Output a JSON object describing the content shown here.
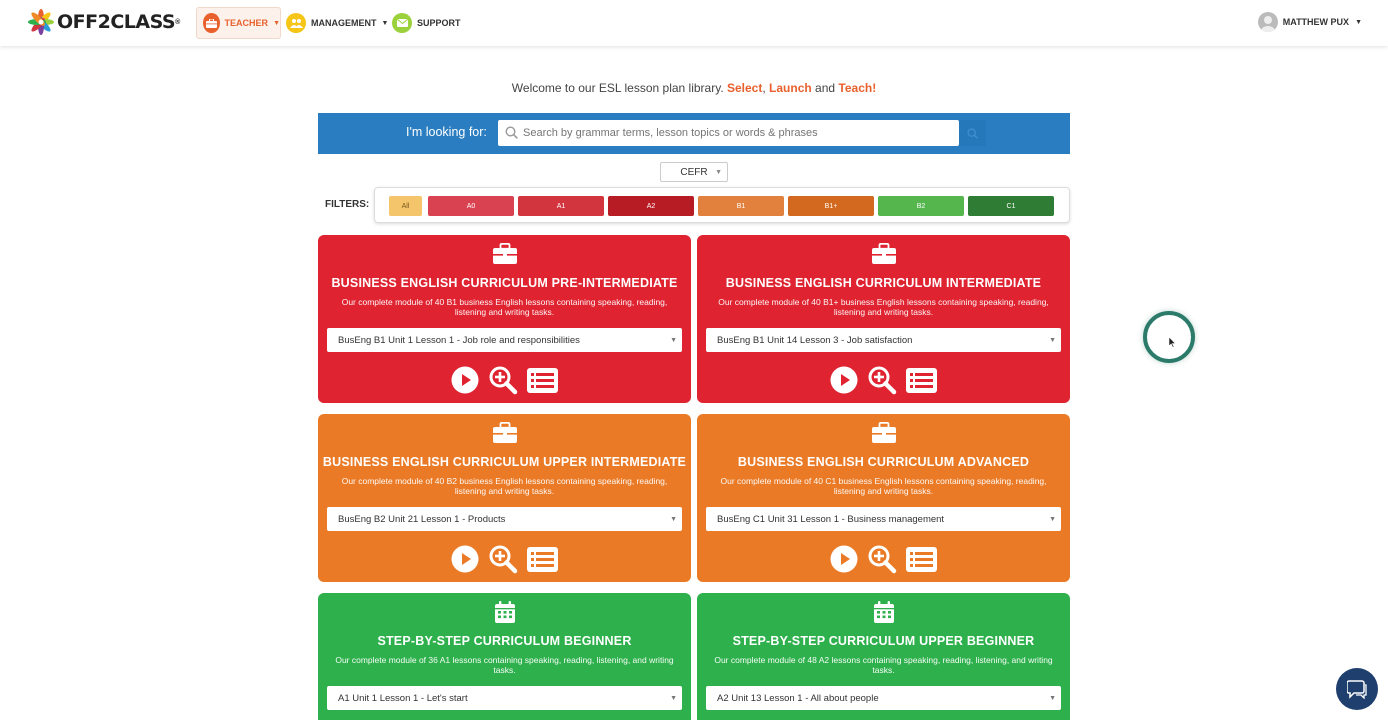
{
  "brand": {
    "name": "OFF2CLASS"
  },
  "nav": {
    "teacher": "TEACHER",
    "management": "MANAGEMENT",
    "support": "SUPPORT"
  },
  "user": {
    "name": "MATTHEW PUX"
  },
  "welcome": {
    "prefix": "Welcome to our ESL lesson plan library. ",
    "select": "Select",
    "comma": ", ",
    "launch": "Launch",
    "and": " and ",
    "teach": "Teach!"
  },
  "search": {
    "label": "I'm looking for:",
    "placeholder": "Search by grammar terms, lesson topics or words & phrases"
  },
  "cefr": {
    "selected": "CEFR"
  },
  "filters": {
    "label": "FILTERS:",
    "pills": [
      {
        "label": "All",
        "color": "#f5c56b"
      },
      {
        "label": "A0",
        "color": "#d94351"
      },
      {
        "label": "A1",
        "color": "#d3353f"
      },
      {
        "label": "A2",
        "color": "#b71c24"
      },
      {
        "label": "B1",
        "color": "#e2813d"
      },
      {
        "label": "B1+",
        "color": "#d2691e"
      },
      {
        "label": "B2",
        "color": "#56b64e"
      },
      {
        "label": "C1",
        "color": "#2f7d34"
      }
    ]
  },
  "cards": [
    {
      "title": "BUSINESS ENGLISH CURRICULUM PRE-INTERMEDIATE",
      "desc": "Our complete module of 40 B1 business English lessons containing speaking, reading, listening and writing tasks.",
      "selected": "BusEng B1 Unit 1 Lesson 1 - Job role and responsibilities",
      "icon": "briefcase-icon"
    },
    {
      "title": "BUSINESS ENGLISH CURRICULUM INTERMEDIATE",
      "desc": "Our complete module of 40 B1+ business English lessons containing speaking, reading, listening and writing tasks.",
      "selected": "BusEng B1 Unit 14 Lesson 3 - Job satisfaction",
      "icon": "briefcase-icon"
    },
    {
      "title": "BUSINESS ENGLISH CURRICULUM UPPER INTERMEDIATE",
      "desc": "Our complete module of 40 B2 business English lessons containing speaking, reading, listening and writing tasks.",
      "selected": "BusEng B2 Unit 21 Lesson 1 - Products",
      "icon": "briefcase-icon"
    },
    {
      "title": "BUSINESS ENGLISH CURRICULUM ADVANCED",
      "desc": "Our complete module of 40 C1 business English lessons containing speaking, reading, listening and writing tasks.",
      "selected": "BusEng C1 Unit 31 Lesson 1 - Business management",
      "icon": "briefcase-icon"
    },
    {
      "title": "STEP-BY-STEP CURRICULUM BEGINNER",
      "desc": "Our complete module of 36 A1 lessons containing speaking, reading, listening, and writing tasks.",
      "selected": "A1 Unit 1 Lesson 1 - Let's start",
      "icon": "calendar-icon"
    },
    {
      "title": "STEP-BY-STEP CURRICULUM UPPER BEGINNER",
      "desc": "Our complete module of 48 A2 lessons containing speaking, reading, listening, and writing tasks.",
      "selected": "A2 Unit 13 Lesson 1 - All about people",
      "icon": "calendar-icon"
    }
  ]
}
